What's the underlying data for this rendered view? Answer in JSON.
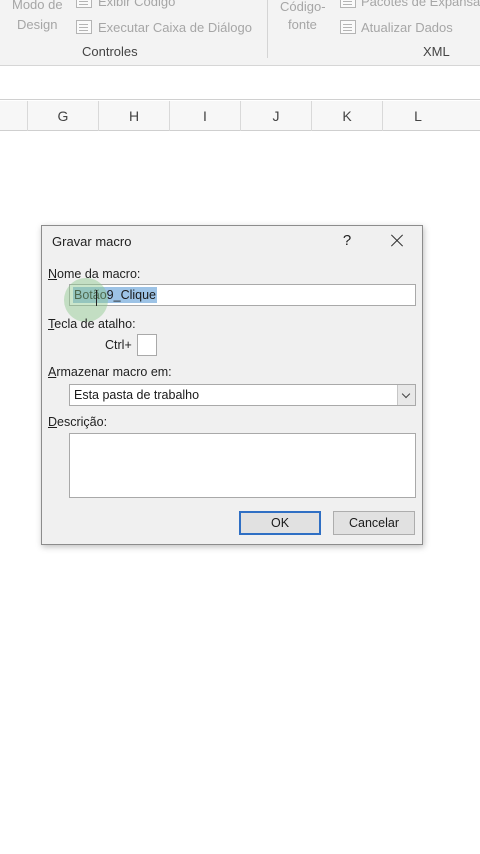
{
  "ribbon": {
    "design_mode_line1": "Modo de",
    "design_mode_line2": "Design",
    "view_code": "Exibir Código",
    "run_dialog": "Executar Caixa de Diálogo",
    "controls_group": "Controles",
    "source_line1": "Código-",
    "source_line2": "fonte",
    "expansion_packs": "Pacotes de Expansão",
    "refresh_data": "Atualizar Dados",
    "xml_group": "XML"
  },
  "columns": [
    "G",
    "H",
    "I",
    "J",
    "K",
    "L"
  ],
  "dialog": {
    "title": "Gravar macro",
    "help": "?",
    "macro_name_underlined": "N",
    "macro_name_label": "ome da macro:",
    "macro_name_value": "Botão9_Clique",
    "shortcut_underlined": "T",
    "shortcut_label": "ecla de atalho:",
    "ctrl_label": "Ctrl+",
    "store_underlined": "A",
    "store_label": "rmazenar macro em:",
    "store_value": "Esta pasta de trabalho",
    "description_underlined": "D",
    "description_label": "escrição:",
    "ok_label": "OK",
    "cancel_label": "Cancelar"
  }
}
